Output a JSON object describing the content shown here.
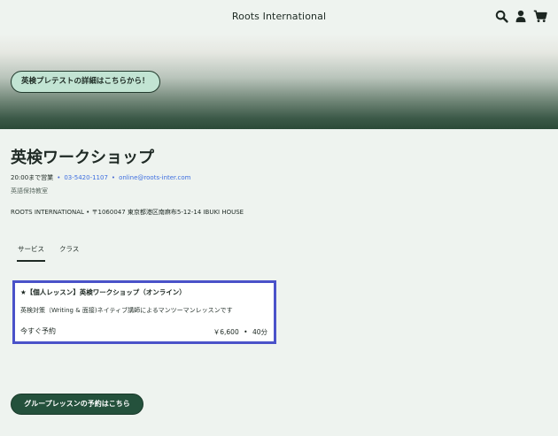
{
  "header": {
    "site_title": "Roots International",
    "icons": [
      "search-icon",
      "user-icon",
      "cart-icon"
    ]
  },
  "hero": {
    "button_label": "英検プレテストの詳細はこちらから！"
  },
  "business": {
    "name": "英検ワークショップ",
    "hours": "20:00まで営業",
    "phone": "03-5420-1107",
    "email": "online@roots-inter.com",
    "category": "英語保持教室",
    "address": "ROOTS INTERNATIONAL • 〒1060047 東京都港区南麻布5-12-14 IBUKI HOUSE"
  },
  "tabs": [
    {
      "label": "サービス",
      "active": true
    },
    {
      "label": "クラス",
      "active": false
    }
  ],
  "service_card": {
    "title": "★【個人レッスン】英検ワークショップ（オンライン）",
    "description": "英検対策（Writing & 面接)ネイティブ講師によるマンツーマンレッスンです",
    "book_label": "今すぐ予約",
    "price": "￥6,600",
    "separator": "•",
    "duration": "40分"
  },
  "group_button": {
    "label": "グループレッスンの予約はこちら"
  },
  "colors": {
    "background": "#eef3ef",
    "accent_green": "#24513c",
    "hero_button_bg": "#c2e4d3",
    "link_blue": "#3e6fe0",
    "card_border": "#4a52c9"
  }
}
